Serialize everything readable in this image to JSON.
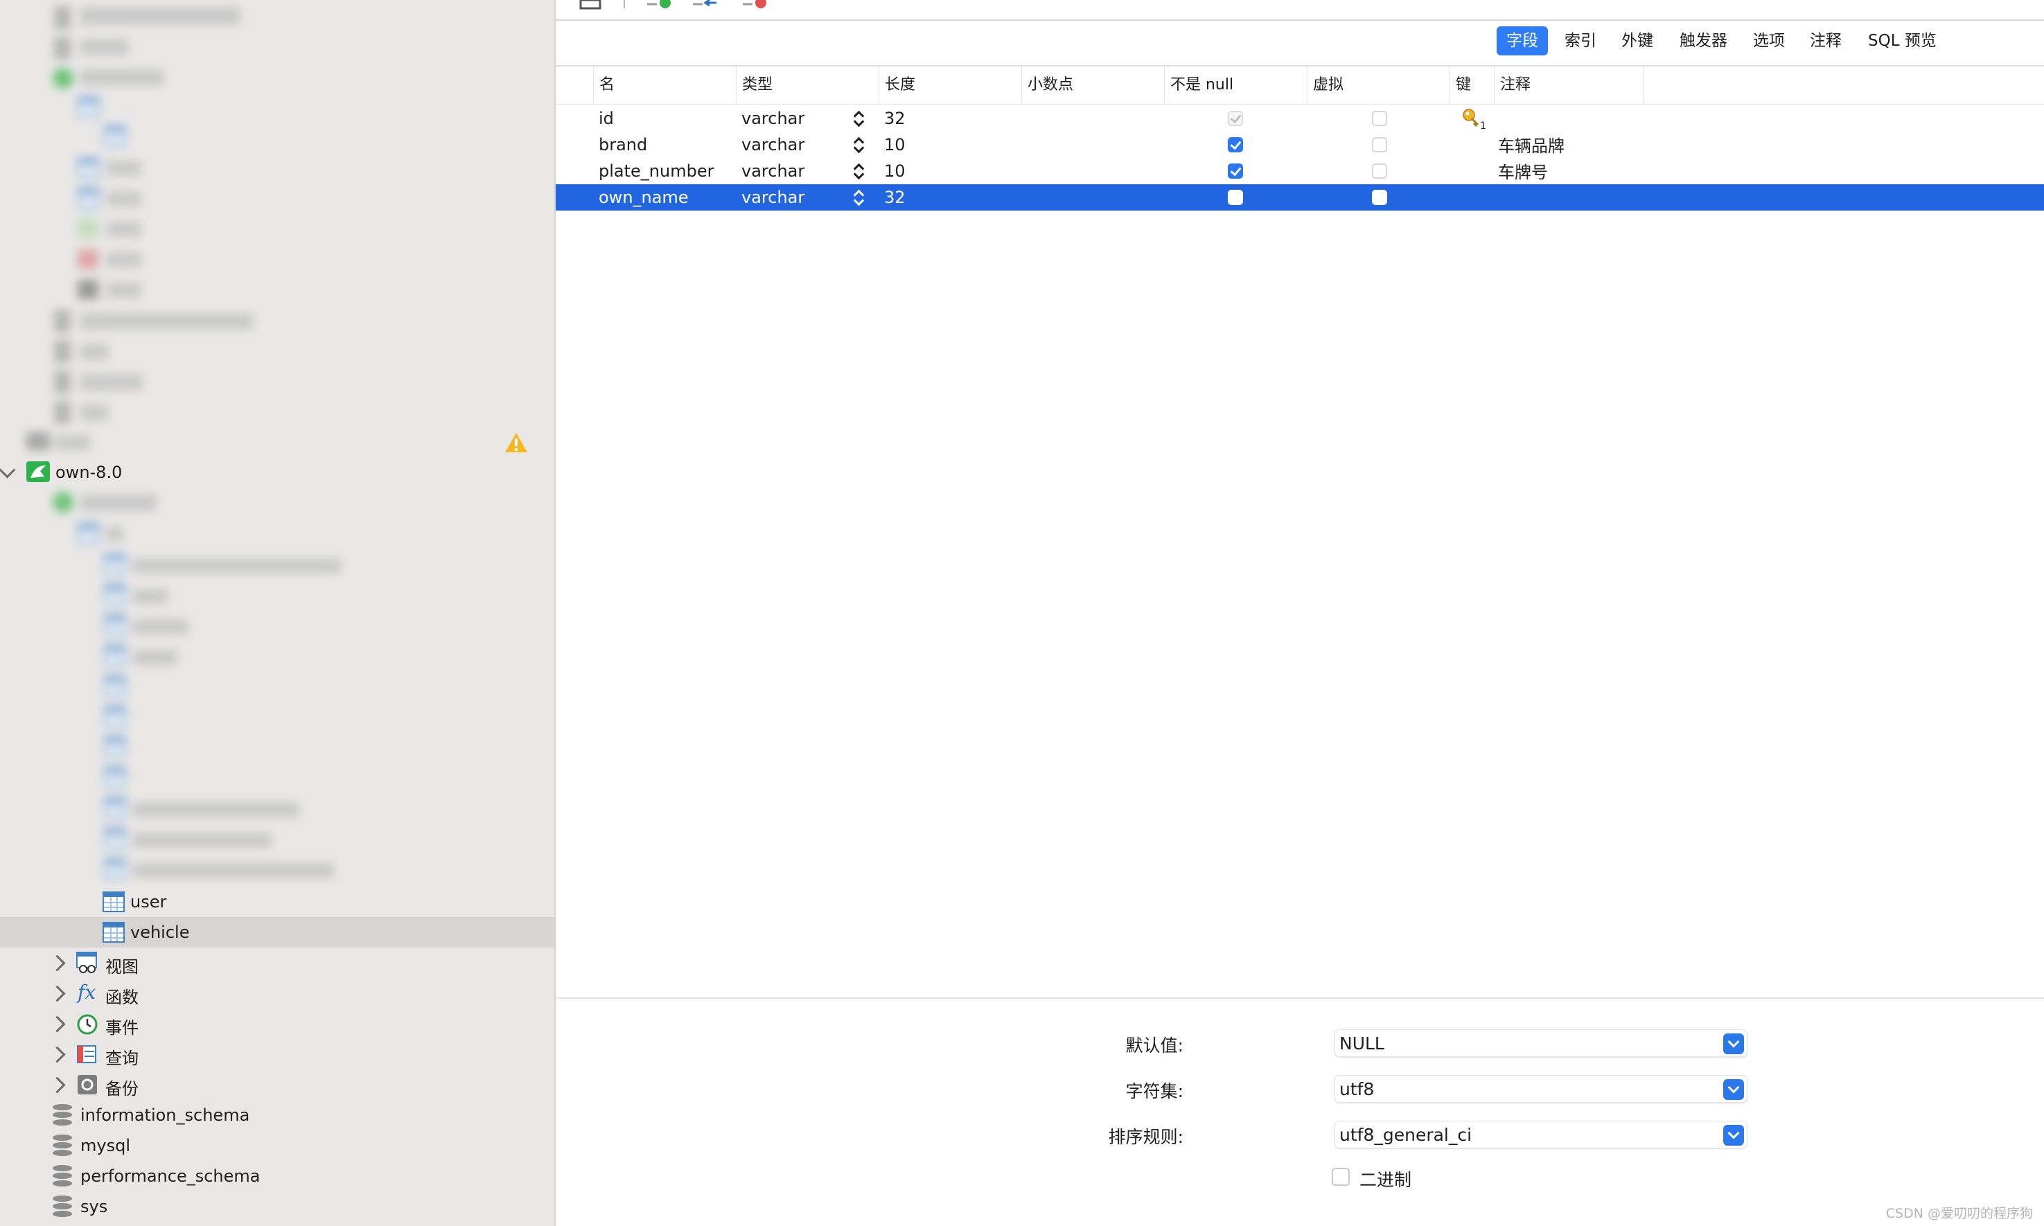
{
  "toolbar": {
    "buttons": [
      "save-icon",
      "add-field-icon",
      "insert-field-icon",
      "delete-field-icon"
    ]
  },
  "tabs": [
    {
      "label": "字段",
      "active": true
    },
    {
      "label": "索引"
    },
    {
      "label": "外键"
    },
    {
      "label": "触发器"
    },
    {
      "label": "选项"
    },
    {
      "label": "注释"
    },
    {
      "label": "SQL 预览"
    }
  ],
  "columns": [
    "名",
    "类型",
    "长度",
    "小数点",
    "不是 null",
    "虚拟",
    "键",
    "注释"
  ],
  "rows": [
    {
      "name": "id",
      "type": "varchar",
      "length": "32",
      "decimals": "",
      "not_null": true,
      "not_null_disabled": true,
      "virtual": false,
      "key": "1",
      "comment": ""
    },
    {
      "name": "brand",
      "type": "varchar",
      "length": "10",
      "decimals": "",
      "not_null": true,
      "virtual": false,
      "key": "",
      "comment": "车辆品牌"
    },
    {
      "name": "plate_number",
      "type": "varchar",
      "length": "10",
      "decimals": "",
      "not_null": true,
      "virtual": false,
      "key": "",
      "comment": "车牌号"
    },
    {
      "name": "own_name",
      "type": "varchar",
      "length": "32",
      "decimals": "",
      "not_null": false,
      "virtual": false,
      "key": "",
      "comment": "",
      "selected": true
    }
  ],
  "sidebar": {
    "connection": "own-8.0",
    "tables": [
      "user",
      "vehicle"
    ],
    "selected_table": "vehicle",
    "groups": [
      "视图",
      "函数",
      "事件",
      "查询",
      "备份"
    ],
    "databases": [
      "information_schema",
      "mysql",
      "performance_schema",
      "sys"
    ],
    "warning_icon": "warning-icon"
  },
  "props": {
    "default_label": "默认值:",
    "default_value": "NULL",
    "charset_label": "字符集:",
    "charset_value": "utf8",
    "collation_label": "排序规则:",
    "collation_value": "utf8_general_ci",
    "binary_label": "二进制"
  },
  "colors": {
    "accent": "#2f7df6",
    "selected_row": "#2166e0",
    "sidebar_bg": "#e9e8e7"
  },
  "watermark": "CSDN @爱叨叨的程序狗"
}
